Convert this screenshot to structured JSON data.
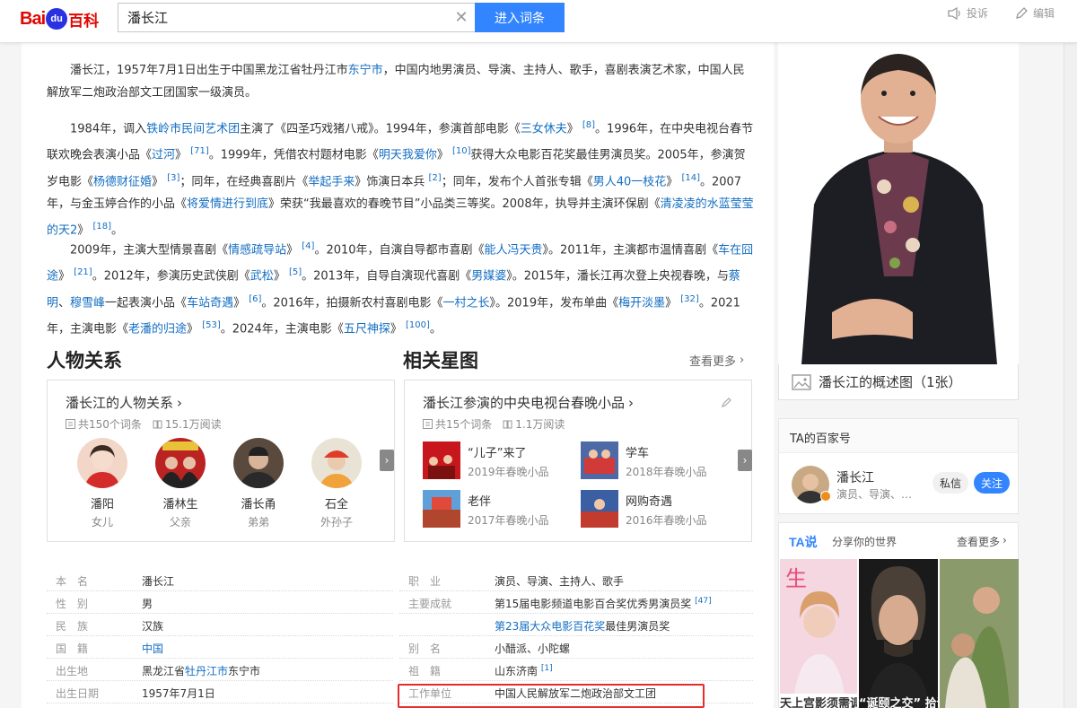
{
  "header": {
    "logo_bai": "Bai",
    "logo_du": "du",
    "logo_ke": "百科",
    "search_value": "潘长江",
    "search_button": "进入词条",
    "report": "投诉",
    "edit": "编辑"
  },
  "paragraphs": {
    "p1": {
      "a": "潘长江，1957年7月1日出生于中国黑龙江省牡丹江市",
      "link1": "东宁市",
      "b": "，中国内地男演员、导演、主持人、歌手，喜剧表演艺术家，中国人民解放军二炮政治部文工团国家一级演员。"
    },
    "p2": {
      "t1": "1984年，调入",
      "l1": "铁岭市民间艺术团",
      "t2": "主演了《四圣巧戏猪八戒》。1994年，参演首部电影《",
      "l2": "三女休夫",
      "t3": "》",
      "r1": "[8]",
      "t4": "。1996年，在中央电视台春节联欢晚会表演小品《",
      "l3": "过河",
      "t5": "》",
      "r2": "[71]",
      "t6": "。1999年，凭借农村题材电影《",
      "l4": "明天我爱你",
      "t7": "》",
      "r3": "[10]",
      "t8": "获得大众电影百花奖最佳男演员奖。2005年，参演贺岁电影《",
      "l5": "杨德财征婚",
      "t9": "》",
      "r4": "[3]",
      "t10": "；同年，在经典喜剧片《",
      "l6": "举起手来",
      "t11": "》饰演日本兵",
      "r5": "[2]",
      "t12": "；同年，发布个人首张专辑《",
      "l7": "男人40一枝花",
      "t13": "》",
      "r6": "[14]",
      "t14": "。2007年，与金玉婷合作的小品《",
      "l8": "将爱情进行到底",
      "t15": "》荣获“我最喜欢的春晚节目”小品类三等奖。2008年，执导并主演环保剧《",
      "l9": "清凌凌的水蓝莹莹的天2",
      "t16": "》",
      "r7": "[18]",
      "t17": "。"
    },
    "p3": {
      "t1": "2009年，主演大型情景喜剧《",
      "l1": "情感疏导站",
      "t2": "》",
      "r1": "[4]",
      "t3": "。2010年，自演自导都市喜剧《",
      "l2": "能人冯天贵",
      "t4": "》。2011年，主演都市温情喜剧《",
      "l3": "车在囧途",
      "t5": "》",
      "r2": "[21]",
      "t6": "。2012年，参演历史武侠剧《",
      "l4": "武松",
      "t7": "》",
      "r3": "[5]",
      "t8": "。2013年，自导自演现代喜剧《",
      "l5": "男媒婆",
      "t9": "》。2015年，潘长江再次登上央视春晚，与",
      "l6": "蔡明",
      "t10": "、",
      "l7": "穆雪峰",
      "t11": "一起表演小品《",
      "l8": "车站奇遇",
      "t12": "》",
      "r4": "[6]",
      "t13": "。2016年，拍摄新农村喜剧电影《",
      "l9": "一村之长",
      "t14": "》。2019年，发布单曲《",
      "l10": "梅开淡墨",
      "t15": "》",
      "r5": "[32]",
      "t16": "。2021年，主演电影《",
      "l11": "老潘的归途",
      "t17": "》",
      "r6": "[53]",
      "t18": "。2024年，主演电影《",
      "l12": "五尺神探",
      "t19": "》",
      "r7": "[100]",
      "t20": "。"
    }
  },
  "relations": {
    "section_title": "人物关系",
    "card_title": "潘长江的人物关系",
    "count": "共150个词条",
    "views": "15.1万阅读",
    "people": [
      {
        "name": "潘阳",
        "role": "女儿"
      },
      {
        "name": "潘林生",
        "role": "父亲"
      },
      {
        "name": "潘长甬",
        "role": "弟弟"
      },
      {
        "name": "石全",
        "role": "外孙子"
      }
    ]
  },
  "star_map": {
    "section_title": "相关星图",
    "more": "查看更多",
    "card_title": "潘长江参演的中央电视台春晚小品",
    "count": "共15个词条",
    "views": "1.1万阅读",
    "shows": [
      {
        "title": "“儿子”来了",
        "year": "2019年春晚小品"
      },
      {
        "title": "学车",
        "year": "2018年春晚小品"
      },
      {
        "title": "老伴",
        "year": "2017年春晚小品"
      },
      {
        "title": "网购奇遇",
        "year": "2016年春晚小品"
      }
    ]
  },
  "info": {
    "left": [
      {
        "label": "本　名",
        "value": "潘长江"
      },
      {
        "label": "性　别",
        "value": "男"
      },
      {
        "label": "民　族",
        "value": "汉族"
      },
      {
        "label": "国　籍",
        "value": "中国"
      },
      {
        "label": "出生地",
        "value_a": "黑龙江省",
        "value_link": "牡丹江市",
        "value_b": "东宁市"
      },
      {
        "label": "出生日期",
        "value": "1957年7月1日"
      }
    ],
    "right": [
      {
        "label": "职　业",
        "value": "演员、导演、主持人、歌手"
      },
      {
        "label": "主要成就",
        "value": "第15届电影频道电影百合奖优秀男演员奖",
        "ref": "[47]"
      },
      {
        "label": "",
        "value_link": "第23届大众电影百花奖",
        "value_b": "最佳男演员奖"
      },
      {
        "label": "别　名",
        "value": "小醋派、小陀螺"
      },
      {
        "label": "祖　籍",
        "value": "山东济南",
        "ref": "[1]"
      },
      {
        "label": "工作单位",
        "value": "中国人民解放军二炮政治部文工团"
      }
    ]
  },
  "sidebar": {
    "caption": "潘长江的概述图（1张）",
    "baijia_title": "TA的百家号",
    "baijia_name": "潘长江",
    "baijia_desc": "演员、导演、…",
    "msg_btn": "私信",
    "follow_btn": "关注",
    "tashuo_logo": "TA说",
    "tashuo_slogan": "分享你的世界",
    "tashuo_more": "查看更多",
    "video_captions": [
      "天上宫影须需调",
      "“诞颐之交” 拾谨拾"
    ]
  },
  "colors": {
    "link": "#136ec2",
    "accent": "#3385ff",
    "highlight": "#e52d2d",
    "brand_red": "#e10601"
  }
}
